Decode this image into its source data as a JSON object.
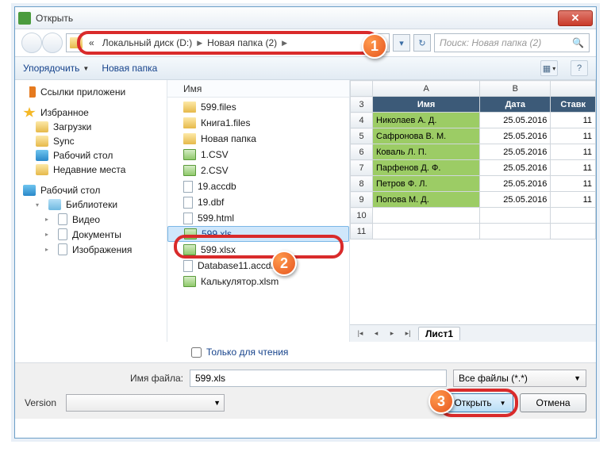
{
  "window": {
    "title": "Открыть"
  },
  "breadcrumb": {
    "prefix": "«",
    "seg1": "Локальный диск (D:)",
    "seg2": "Новая папка (2)"
  },
  "search": {
    "placeholder": "Поиск: Новая папка (2)"
  },
  "toolbar": {
    "organize": "Упорядочить",
    "newfolder": "Новая папка"
  },
  "sidebar": {
    "group1_head": "Ссылки приложени",
    "fav_head": "Избранное",
    "fav_items": [
      "Загрузки",
      "Sync",
      "Рабочий стол",
      "Недавние места"
    ],
    "desk_head": "Рабочий стол",
    "lib_head": "Библиотеки",
    "lib_items": [
      "Видео",
      "Документы",
      "Изображения"
    ]
  },
  "filecol": {
    "header": "Имя",
    "files": [
      {
        "name": "599.files",
        "type": "fld"
      },
      {
        "name": "Книга1.files",
        "type": "fld"
      },
      {
        "name": "Новая папка",
        "type": "fld"
      },
      {
        "name": "1.CSV",
        "type": "csv"
      },
      {
        "name": "2.CSV",
        "type": "csv"
      },
      {
        "name": "19.accdb",
        "type": "db"
      },
      {
        "name": "19.dbf",
        "type": "db"
      },
      {
        "name": "599.html",
        "type": "db"
      },
      {
        "name": "599.xls",
        "type": "xls",
        "selected": true
      },
      {
        "name": "599.xlsx",
        "type": "xls"
      },
      {
        "name": "Database11.accdb",
        "type": "db"
      },
      {
        "name": "Калькулятор.xlsm",
        "type": "xls"
      }
    ]
  },
  "preview": {
    "cols": [
      "A",
      "B",
      ""
    ],
    "header_row": [
      "Имя",
      "Дата",
      "Ставк"
    ],
    "rows": [
      {
        "r": 4,
        "name": "Николаев А. Д.",
        "date": "25.05.2016",
        "val": "11"
      },
      {
        "r": 5,
        "name": "Сафронова В. М.",
        "date": "25.05.2016",
        "val": "11"
      },
      {
        "r": 6,
        "name": "Коваль Л. П.",
        "date": "25.05.2016",
        "val": "11"
      },
      {
        "r": 7,
        "name": "Парфенов Д. Ф.",
        "date": "25.05.2016",
        "val": "11"
      },
      {
        "r": 8,
        "name": "Петров Ф. Л.",
        "date": "25.05.2016",
        "val": "11"
      },
      {
        "r": 9,
        "name": "Попова М. Д.",
        "date": "25.05.2016",
        "val": "11"
      }
    ],
    "empty_rows": [
      10,
      11
    ],
    "sheet_tab": "Лист1"
  },
  "readonly_label": "Только для чтения",
  "form": {
    "filename_label": "Имя файла:",
    "filename_value": "599.xls",
    "filter_value": "Все файлы (*.*)",
    "version_label": "Version",
    "open_btn": "Открыть",
    "cancel_btn": "Отмена"
  },
  "callouts": {
    "c1": "1",
    "c2": "2",
    "c3": "3"
  }
}
